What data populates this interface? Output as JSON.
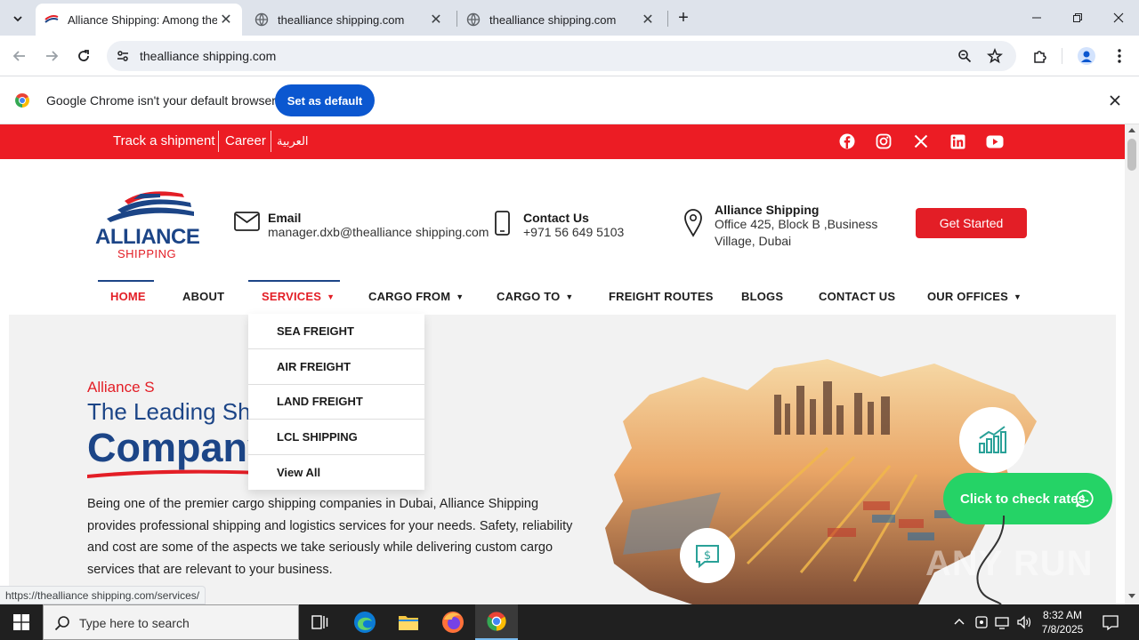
{
  "browser": {
    "tabs": [
      {
        "title": "Alliance Shipping: Among the T",
        "active": true
      },
      {
        "title": "thealliance shipping.com",
        "active": false
      },
      {
        "title": "thealliance shipping.com",
        "active": false
      }
    ],
    "address": "thealliance shipping.com",
    "infobar": {
      "message": "Google Chrome isn't your default browser",
      "button": "Set as default"
    },
    "status_url": "https://thealliance shipping.com/services/"
  },
  "site": {
    "topbar_links": [
      "Track a shipment",
      "Career",
      "العربية"
    ],
    "social_icons": [
      "facebook-icon",
      "instagram-icon",
      "x-icon",
      "linkedin-icon",
      "youtube-icon"
    ],
    "logo": {
      "line1": "ALLIANCE",
      "line2": "SHIPPING"
    },
    "contact": {
      "email_label": "Email",
      "email_value": "manager.dxb@thealliance shipping.com",
      "phone_label": "Contact Us",
      "phone_value": "+971 56 649 5103",
      "address_label": "Alliance Shipping",
      "address_line1": "Office 425, Block B ,Business",
      "address_line2": "Village, Dubai"
    },
    "cta": "Get Started",
    "menu": [
      "HOME",
      "ABOUT",
      "SERVICES",
      "CARGO FROM",
      "CARGO TO",
      "FREIGHT ROUTES",
      "BLOGS",
      "CONTACT US",
      "OUR OFFICES"
    ],
    "services_dropdown": [
      "SEA FREIGHT",
      "AIR FREIGHT",
      "LAND FREIGHT",
      "LCL SHIPPING",
      "View All"
    ],
    "hero": {
      "kicker": "Alliance S",
      "heading_partial": "The Leading Sh",
      "heading_big": "Company",
      "body": [
        "Being one of the premier cargo shipping companies in Dubai, Alliance Shipping",
        "provides professional shipping and logistics services for your needs. Safety, reliability",
        "and cost are some of the aspects we take seriously while delivering custom cargo",
        "services that are relevant to your business."
      ]
    },
    "whatsapp_cta": "Click to check rates",
    "watermark": "ANY RUN"
  },
  "taskbar": {
    "search_placeholder": "Type here to search",
    "time": "8:32 AM",
    "date": "7/8/2025"
  },
  "colors": {
    "brand_red": "#ec1c24",
    "brand_blue": "#1c4587",
    "whatsapp": "#25d366",
    "chrome_blue": "#0b57d0"
  }
}
